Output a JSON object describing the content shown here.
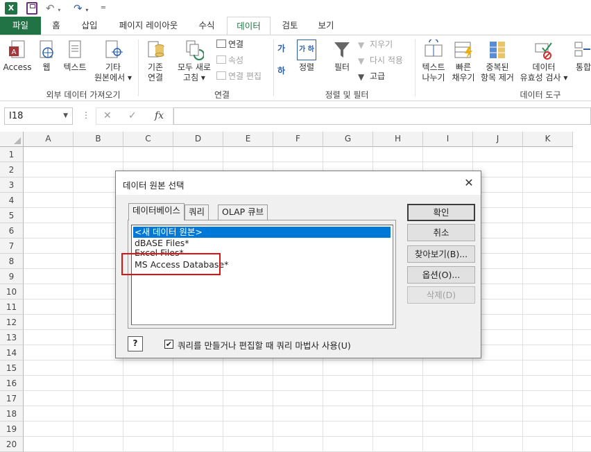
{
  "qat": {
    "logo": "X",
    "undo": "↶",
    "redo": "↷"
  },
  "tabs": [
    "파일",
    "홈",
    "삽입",
    "페이지 레이아웃",
    "수식",
    "데이터",
    "검토",
    "보기"
  ],
  "ribbon": {
    "external": {
      "access": "Access",
      "web": "웹",
      "text": "텍스트",
      "other": [
        "기타",
        "원본에서 ▾"
      ],
      "group": "외부 데이터 가져오기"
    },
    "existing": [
      "기존",
      "연결"
    ],
    "refresh": [
      "모두 새로",
      "고침 ▾"
    ],
    "connections": {
      "connect": "연결",
      "properties": "속성",
      "edit_links": "연결 편집",
      "group": "연결"
    },
    "sort": {
      "sort": "정렬",
      "filter": "필터",
      "clear": "지우기",
      "reapply": "다시 적용",
      "advanced": "고급",
      "group": "정렬 및 필터",
      "az": "가",
      "za": "하",
      "sortbox": "가 하"
    },
    "tools": {
      "text_to_columns": [
        "텍스트",
        "나누기"
      ],
      "flash_fill": [
        "빠른",
        "채우기"
      ],
      "remove_dup": [
        "중복된",
        "항목 제거"
      ],
      "validation": [
        "데이터",
        "유효성 검사 ▾"
      ],
      "consolidate": "통합",
      "group": "데이터 도구"
    }
  },
  "formula_bar": {
    "name_box": "I18",
    "fx": "fx",
    "cancel": "✕",
    "enter": "✓",
    "dots": "⋮"
  },
  "grid": {
    "columns": [
      "A",
      "B",
      "C",
      "D",
      "E",
      "F",
      "G",
      "H",
      "I",
      "J",
      "K"
    ],
    "rows": [
      "1",
      "2",
      "3",
      "4",
      "5",
      "6",
      "7",
      "8",
      "9",
      "10",
      "11",
      "12",
      "13",
      "14",
      "15",
      "16",
      "17",
      "18",
      "19",
      "20"
    ]
  },
  "dialog": {
    "title": "데이터 원본 선택",
    "close": "✕",
    "tabs": [
      "데이터베이스",
      "쿼리",
      "OLAP 큐브"
    ],
    "list": [
      "<새 데이터 원본>",
      "dBASE Files*",
      "Excel Files*",
      "MS Access Database*"
    ],
    "buttons": {
      "ok": "확인",
      "cancel": "취소",
      "browse": "찾아보기(B)...",
      "options": "옵션(O)...",
      "delete": "삭제(D)"
    },
    "help": "?",
    "checkbox_checked": "✔",
    "checkbox_label": "쿼리를 만들거나 편집할 때 쿼리 마법사 사용(U)"
  },
  "colors": {
    "excel_green": "#217346",
    "selection": "#0078d7",
    "highlight": "#e01010"
  }
}
